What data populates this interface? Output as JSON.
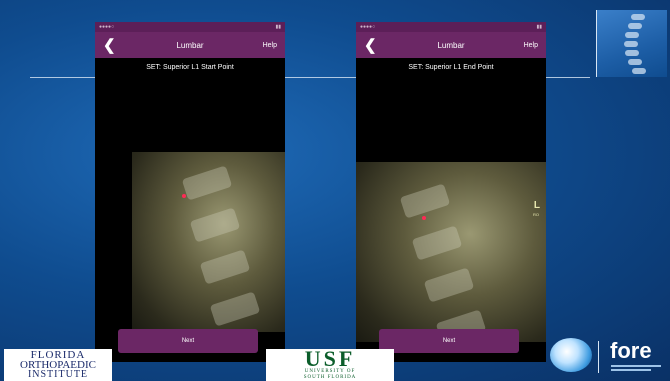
{
  "slide": {
    "phones": [
      {
        "nav_title": "Lumbar",
        "back_glyph": "❮",
        "help_label": "Help",
        "set_label": "SET: Superior L1 Start Point",
        "next_label": "Next",
        "xray_labels": null
      },
      {
        "nav_title": "Lumbar",
        "back_glyph": "❮",
        "help_label": "Help",
        "set_label": "SET: Superior L1 End Point",
        "next_label": "Next",
        "xray_labels": {
          "l": "L",
          "ro": "RO"
        }
      }
    ],
    "logos": {
      "florida_ortho": [
        "FLORIDA",
        "ORTHOPAEDIC",
        "INSTITUTE"
      ],
      "usf": {
        "big": "USF",
        "small": [
          "UNIVERSITY OF",
          "SOUTH FLORIDA"
        ]
      },
      "fore": "fore"
    },
    "icons": [
      "back-chevron-icon",
      "spine-icon",
      "orb-icon"
    ],
    "colors": {
      "nav": "#6b2765",
      "background": "#0f4c8f",
      "marker": "#ff2a55"
    }
  }
}
